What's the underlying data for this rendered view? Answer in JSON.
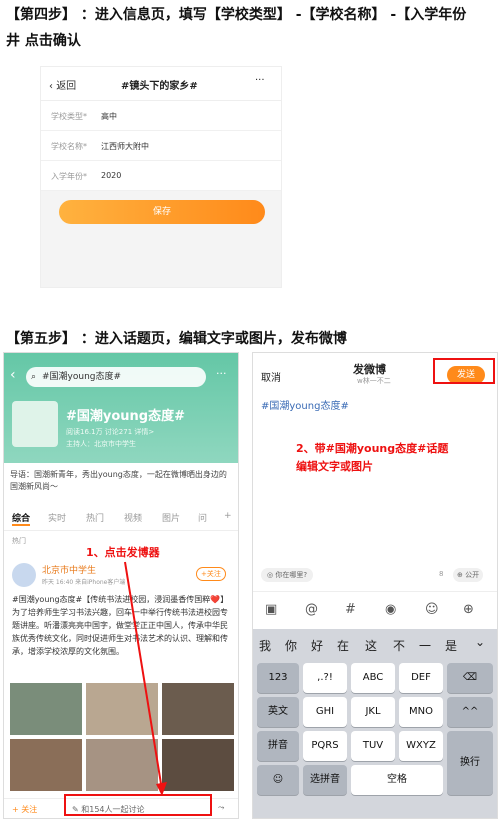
{
  "step4": {
    "title_line1": "【第四步】 ：进入信息页，填写【学校类型】 -【学校名称】 -【入学年份",
    "title_line2": "井 点击确认",
    "back": "返回",
    "header_title": "#镜头下的家乡#",
    "more": "···",
    "rows": [
      {
        "label": "学校类型*",
        "value": "高中"
      },
      {
        "label": "学校名称*",
        "value": "江西师大附中"
      },
      {
        "label": "入学年份*",
        "value": "2020"
      }
    ],
    "save": "保存"
  },
  "step5": {
    "title": "【第五步】 ：进入话题页，编辑文字或图片，发布微博",
    "left": {
      "search_text": "#国潮young态度#",
      "more": "···",
      "topic_title": "#国潮young态度#",
      "stats": "阅读16.1万  讨论271  详情>",
      "host": "主持人：北京市中学生",
      "guide": "导语：国潮新青年，秀出young态度，一起在微博晒出身边的国潮新风尚～",
      "tabs": [
        "综合",
        "实时",
        "热门",
        "视频",
        "图片",
        "问"
      ],
      "plus": "+",
      "hot": "热门",
      "user": "北京市中学生",
      "meta": "昨天 16:40  来自iPhone客户端",
      "follow": "+关注",
      "post_text": "#国潮young态度#【传统书法进校园，浸润墨香传国粹❤️】为了培养师生学习书法兴趣，回车一中举行传统书法进校园专题讲座。听潘漂亮亮中国字，做堂堂正正中国人，传承中华民族优秀传统文化，同时促进师生对书法艺术的认识、理解和传承，增添学校浓厚的文化氛围。",
      "follow_bottom": "+ 关注",
      "discuss": "和154人一起讨论",
      "annotation": "1、点击发博器"
    },
    "right": {
      "cancel": "取消",
      "title": "发微博",
      "subtitle": "w林一不二",
      "send": "发送",
      "content": "#国潮young态度#",
      "annotation_line1": "2、带#国潮young态度#话题",
      "annotation_line2": "编辑文字或图片",
      "where": "你在哪里?",
      "count": "8",
      "public": "公开",
      "candidates": [
        "我",
        "你",
        "好",
        "在",
        "这",
        "不",
        "一",
        "是"
      ],
      "keys_row1": [
        "123",
        ",.?!",
        "ABC",
        "DEF"
      ],
      "keys_row2": [
        "英文",
        "GHI",
        "JKL",
        "MNO",
        "^^"
      ],
      "keys_row3": [
        "拼音",
        "PQRS",
        "TUV",
        "WXYZ",
        "换行"
      ],
      "keys_row4": [
        "选拼音",
        "空格"
      ]
    }
  },
  "colors": {
    "accent": "#ff8a1a",
    "annotation_red": "#e11111",
    "topic_blue": "#3a6bb5"
  }
}
